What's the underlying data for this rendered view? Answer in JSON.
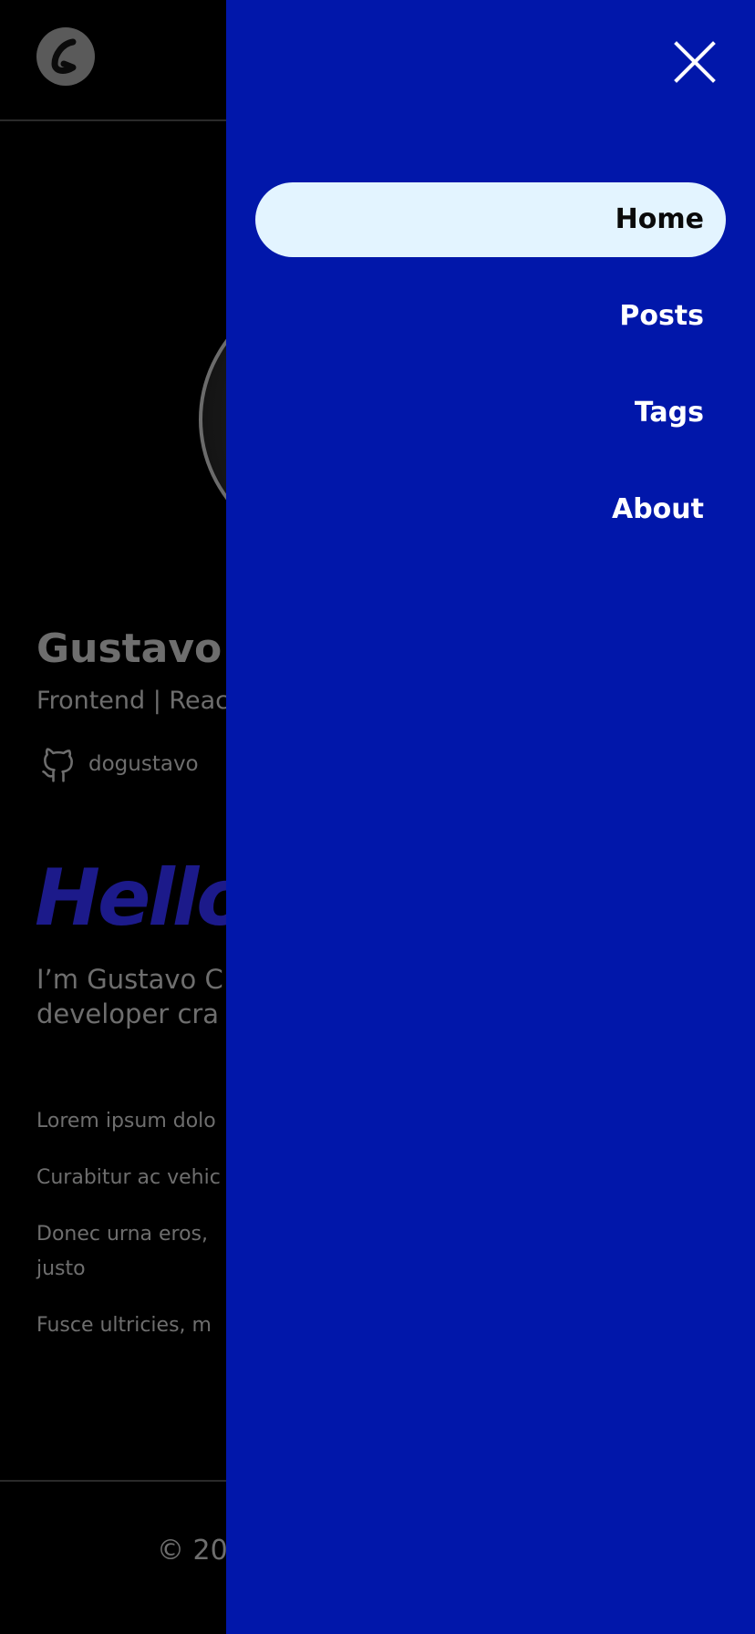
{
  "header": {
    "logo_icon": "logo-g-icon"
  },
  "profile": {
    "name": "Gustavo",
    "role": "Frontend | Reac",
    "github_icon": "github-icon",
    "github_handle": "dogustavo"
  },
  "main": {
    "heading": "Hello",
    "intro_line1": "I’m Gustavo C",
    "intro_line2": "developer cra",
    "paragraphs": [
      "Lorem ipsum dolo",
      "Curabitur ac vehic",
      "Donec urna eros,",
      "justo",
      "Fusce ultricies, m"
    ]
  },
  "footer": {
    "copyright": "© 20"
  },
  "drawer": {
    "close_icon": "close-icon",
    "items": [
      {
        "label": "Home",
        "active": true
      },
      {
        "label": "Posts",
        "active": false
      },
      {
        "label": "Tags",
        "active": false
      },
      {
        "label": "About",
        "active": false
      }
    ]
  },
  "colors": {
    "drawer_bg": "#0117aa",
    "active_item_bg": "#e3f4ff",
    "hello_text": "#1c1a8a"
  }
}
